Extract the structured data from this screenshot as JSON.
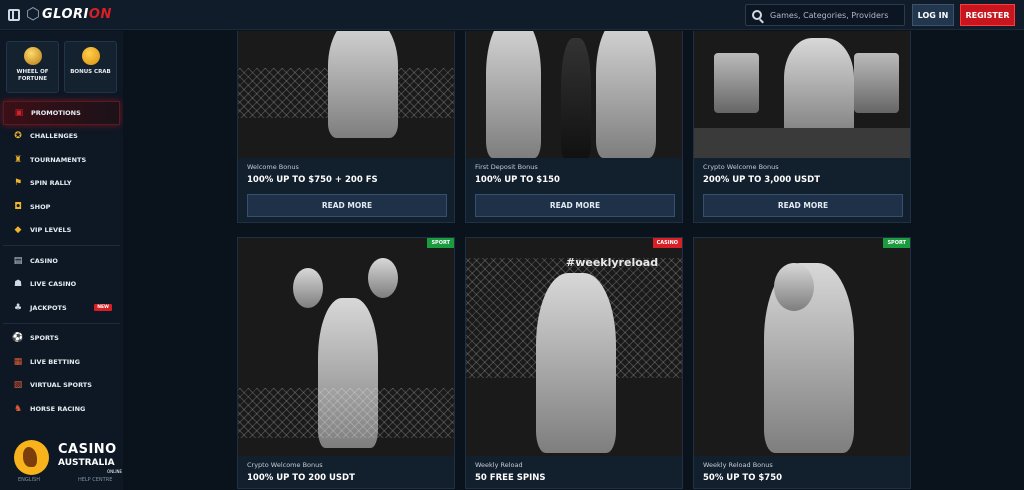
{
  "header": {
    "logo_text": "GLORI",
    "logo_accent": "ON",
    "search_placeholder": "Games, Categories, Providers",
    "login_label": "LOG IN",
    "register_label": "REGISTER"
  },
  "sidebar": {
    "tiles": [
      {
        "label": "WHEEL OF FORTUNE",
        "icon": "wheel-coin-icon"
      },
      {
        "label": "BONUS CRAB",
        "icon": "crab-coin-icon"
      }
    ],
    "group1": [
      {
        "label": "PROMOTIONS",
        "icon": "gift-icon",
        "active": true
      },
      {
        "label": "CHALLENGES",
        "icon": "medal-icon"
      },
      {
        "label": "TOURNAMENTS",
        "icon": "trophy-icon"
      },
      {
        "label": "SPIN RALLY",
        "icon": "flag-icon"
      },
      {
        "label": "SHOP",
        "icon": "basket-icon"
      },
      {
        "label": "VIP LEVELS",
        "icon": "diamond-icon"
      }
    ],
    "group2": [
      {
        "label": "CASINO",
        "icon": "slot-icon"
      },
      {
        "label": "LIVE CASINO",
        "icon": "dealer-icon"
      },
      {
        "label": "JACKPOTS",
        "icon": "clover-icon",
        "badge": "NEW"
      }
    ],
    "group3": [
      {
        "label": "SPORTS",
        "icon": "ball-icon"
      },
      {
        "label": "LIVE BETTING",
        "icon": "live-icon"
      },
      {
        "label": "VIRTUAL SPORTS",
        "icon": "virtual-icon"
      },
      {
        "label": "HORSE RACING",
        "icon": "horse-icon"
      }
    ],
    "footer": {
      "language": "ENGLISH",
      "help": "HELP CENTRE"
    },
    "watermark": {
      "line1": "CASINO",
      "line2": "AUSTRALIA",
      "line3": "ONLINE"
    }
  },
  "cards": [
    {
      "category": "Welcome Bonus",
      "title": "100% UP TO $750 + 200 FS",
      "button": "READ MORE"
    },
    {
      "category": "First Deposit Bonus",
      "title": "100% UP TO $150",
      "button": "READ MORE"
    },
    {
      "category": "Crypto Welcome Bonus",
      "title": "200% UP TO 3,000 USDT",
      "button": "READ MORE"
    },
    {
      "category": "Crypto Welcome Bonus",
      "title": "100% UP TO 200 USDT",
      "tag": "SPORT"
    },
    {
      "category": "Weekly Reload",
      "title": "50 FREE SPINS",
      "tag": "CASINO",
      "image_text": "#weeklyreload"
    },
    {
      "category": "Weekly Reload Bonus",
      "title": "50% UP TO $750",
      "tag": "SPORT"
    }
  ],
  "colors": {
    "accent_red": "#d71f26",
    "sport_green": "#1a9b3e",
    "background": "#0a121c"
  }
}
